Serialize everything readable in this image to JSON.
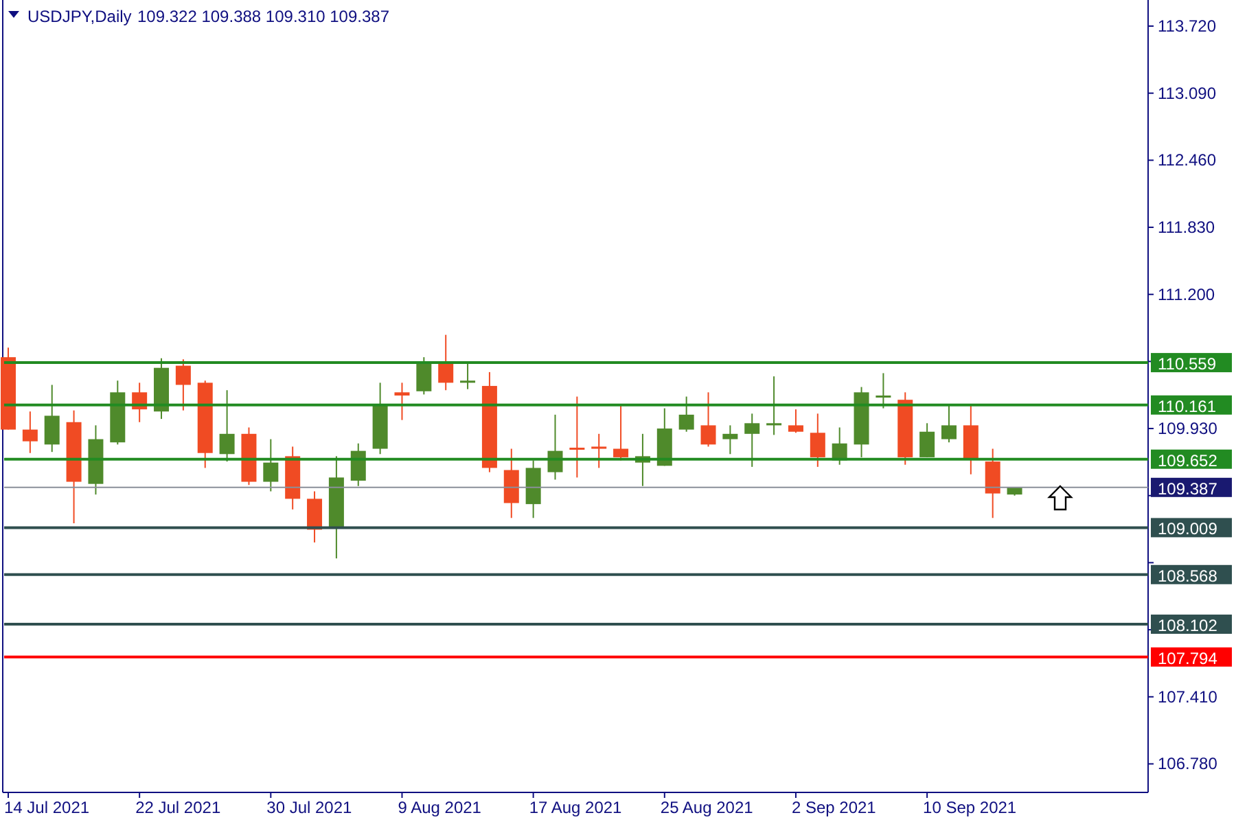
{
  "header": {
    "symbol": "USDJPY,Daily",
    "prices": [
      "109.322",
      "109.388",
      "109.310",
      "109.387"
    ]
  },
  "price_axis": {
    "labels": [
      "113.720",
      "113.090",
      "112.460",
      "111.830",
      "111.200",
      "109.930",
      "107.410",
      "106.780"
    ]
  },
  "date_axis": {
    "labels": [
      "14 Jul 2021",
      "22 Jul 2021",
      "30 Jul 2021",
      "9 Aug 2021",
      "17 Aug 2021",
      "25 Aug 2021",
      "2 Sep 2021",
      "10 Sep 2021"
    ]
  },
  "horizontal_lines": [
    {
      "kind": "level",
      "label": "110.559",
      "color": "#228b22"
    },
    {
      "kind": "level",
      "label": "110.161",
      "color": "#228b22"
    },
    {
      "kind": "level",
      "label": "109.652",
      "color": "#228b22"
    },
    {
      "kind": "current_price",
      "label": "109.387",
      "color": "#191970"
    },
    {
      "kind": "level",
      "label": "109.009",
      "color": "#2f4f4f"
    },
    {
      "kind": "level",
      "label": "108.568",
      "color": "#2f4f4f"
    },
    {
      "kind": "level",
      "label": "108.102",
      "color": "#2f4f4f"
    },
    {
      "kind": "level",
      "label": "107.794",
      "color": "#ff0000"
    }
  ]
}
